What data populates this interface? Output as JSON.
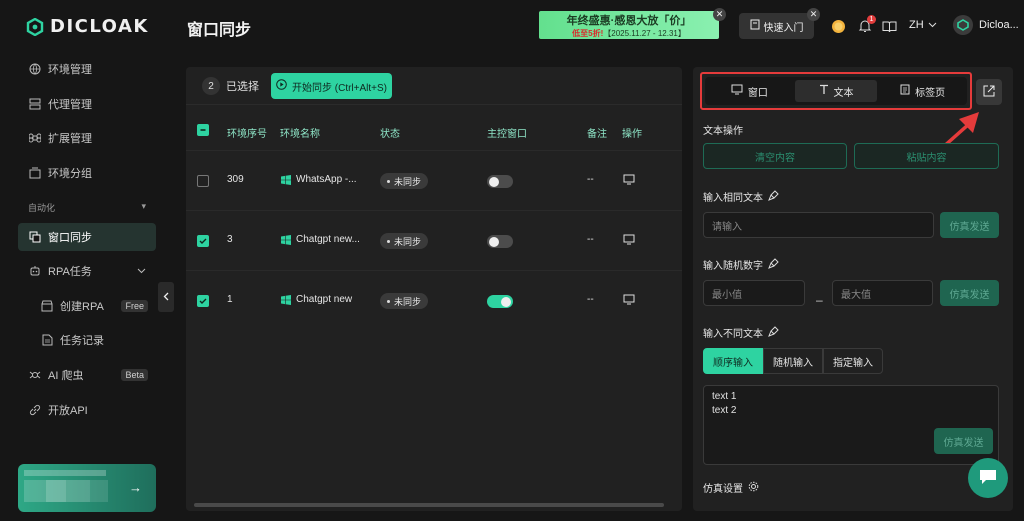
{
  "brand": {
    "logo_text": "DICLOAK"
  },
  "sidebar": {
    "items": [
      {
        "label": "环境管理"
      },
      {
        "label": "代理管理"
      },
      {
        "label": "扩展管理"
      },
      {
        "label": "环境分组"
      }
    ],
    "section_label": "自动化",
    "auto_items": [
      {
        "label": "窗口同步"
      },
      {
        "label": "RPA任务"
      },
      {
        "label": "创建RPA",
        "badge": "Free"
      },
      {
        "label": "任务记录"
      },
      {
        "label": "AI 爬虫",
        "badge": "Beta"
      },
      {
        "label": "开放API"
      }
    ]
  },
  "header": {
    "page_title": "窗口同步",
    "banner_line1": "年终盛惠·感恩大放「价」",
    "banner_line2_red": "低至5折!",
    "banner_line2": "【2025.11.27 - 12.31】",
    "quick_entry": "快速入门",
    "notification_count": "1",
    "language": "ZH",
    "user_name": "Dicloa..."
  },
  "toolbar": {
    "selected_count": "2",
    "selected_label": "已选择",
    "start_sync": "开始同步 (Ctrl+Alt+S)"
  },
  "table": {
    "columns": [
      "环境序号",
      "环境名称",
      "状态",
      "主控窗口",
      "备注",
      "操作"
    ],
    "rows": [
      {
        "id": "309",
        "name": "WhatsApp -...",
        "status": "未同步",
        "master": false,
        "checked": false,
        "note": "--"
      },
      {
        "id": "3",
        "name": "Chatgpt new...",
        "status": "未同步",
        "master": false,
        "checked": true,
        "note": "--"
      },
      {
        "id": "1",
        "name": "Chatgpt new",
        "status": "未同步",
        "master": true,
        "checked": true,
        "note": "--"
      }
    ]
  },
  "right": {
    "tabs": [
      {
        "label": "窗口"
      },
      {
        "label": "文本"
      },
      {
        "label": "标签页"
      }
    ],
    "text_ops_label": "文本操作",
    "clear_btn": "清空内容",
    "paste_btn": "粘贴内容",
    "same_text_label": "输入相同文本",
    "same_text_placeholder": "请输入",
    "send_label": "仿真发送",
    "random_num_label": "输入随机数字",
    "min_placeholder": "最小值",
    "max_placeholder": "最大值",
    "range_dash": "–",
    "diff_text_label": "输入不同文本",
    "modes": [
      "顺序输入",
      "随机输入",
      "指定输入"
    ],
    "textarea_lines": [
      "text 1",
      "text 2"
    ],
    "sim_settings_label": "仿真设置"
  },
  "colors": {
    "accent": "#2ED3A1",
    "highlight": "#E53B3B",
    "panel": "#212121",
    "background": "#161616"
  }
}
